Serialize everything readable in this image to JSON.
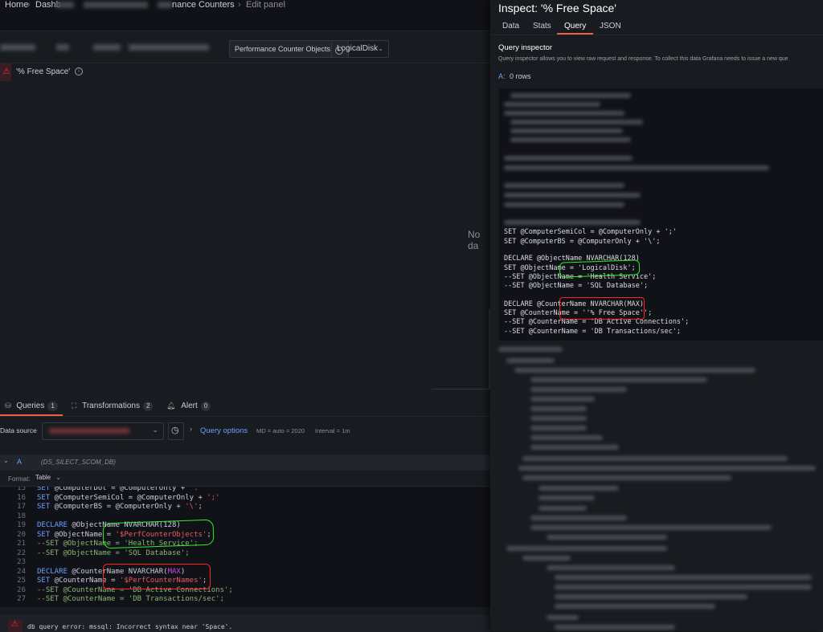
{
  "breadcrumbs": [
    "Home",
    "Dashb",
    "nance Counters",
    "Edit panel"
  ],
  "variables": {
    "counter_objects_label": "Performance Counter Objects",
    "counter_objects_value": "LogicalDisk"
  },
  "panel": {
    "title": "'% Free Space'",
    "no_data": "No da"
  },
  "editor_tabs": {
    "queries_label": "Queries",
    "queries_count": "1",
    "transformations_label": "Transformations",
    "transformations_count": "2",
    "alert_label": "Alert",
    "alert_count": "0"
  },
  "datasource": {
    "label": "Data source",
    "query_options": "Query options",
    "md": "MD = auto = 2020",
    "interval": "Interval = 1m"
  },
  "query": {
    "ref": "A",
    "ds_name": "(DS_SILECT_SCOM_DB)",
    "format_label": "Format:",
    "format_value": "Table"
  },
  "editor_lines": [
    {
      "n": "15",
      "t": "SET @ComputerDot = @ComputerOnly + '.'"
    },
    {
      "n": "16",
      "t": "SET @ComputerSemiCol = @ComputerOnly + ';'"
    },
    {
      "n": "17",
      "t": "SET @ComputerBS = @ComputerOnly + '\\';"
    },
    {
      "n": "18",
      "t": ""
    },
    {
      "n": "19",
      "t": "DECLARE @ObjectName NVARCHAR(128)"
    },
    {
      "n": "20",
      "t": "SET @ObjectName = '$PerfCounterObjects';"
    },
    {
      "n": "21",
      "t": "--SET @ObjectName = 'Health Service';"
    },
    {
      "n": "22",
      "t": "--SET @ObjectName = 'SQL Database';"
    },
    {
      "n": "23",
      "t": ""
    },
    {
      "n": "24",
      "t": "DECLARE @CounterName NVARCHAR(MAX)"
    },
    {
      "n": "25",
      "t": "SET @CounterName = '$PerfCounterNames';"
    },
    {
      "n": "26",
      "t": "--SET @CounterName = 'DB Active Connections';"
    },
    {
      "n": "27",
      "t": "--SET @CounterName = 'DB Transactions/sec';"
    }
  ],
  "error": "db query error: mssql: Incorrect syntax near 'Space'.",
  "inspect": {
    "title": "Inspect: '% Free Space'",
    "tabs": [
      "Data",
      "Stats",
      "Query",
      "JSON"
    ],
    "active_tab": "Query",
    "section_title": "Query inspector",
    "description": "Query inspector allows you to view raw request and response. To collect this data Grafana needs to issue a new que",
    "result_ref": "A:",
    "result_rows": "0 rows",
    "raw_lines": [
      "SET @ComputerSemiCol = @ComputerOnly + ';'",
      "SET @ComputerBS = @ComputerOnly + '\\';",
      "",
      "DECLARE @ObjectName NVARCHAR(128)",
      "SET @ObjectName = 'LogicalDisk';",
      "--SET @ObjectName = 'Health Service';",
      "--SET @ObjectName = 'SQL Database';",
      "",
      "DECLARE @CounterName NVARCHAR(MAX)",
      "SET @CounterName = ''% Free Space'';",
      "--SET @CounterName = 'DB Active Connections';",
      "--SET @CounterName = 'DB Transactions/sec';"
    ]
  },
  "colors": {
    "background": "#181b1f",
    "active_tab_underline": "#f55f3e",
    "link_blue": "#6e9fff",
    "error_red": "#e02f44",
    "highlight_green": "#2cf02c",
    "highlight_red": "#ff2020"
  }
}
